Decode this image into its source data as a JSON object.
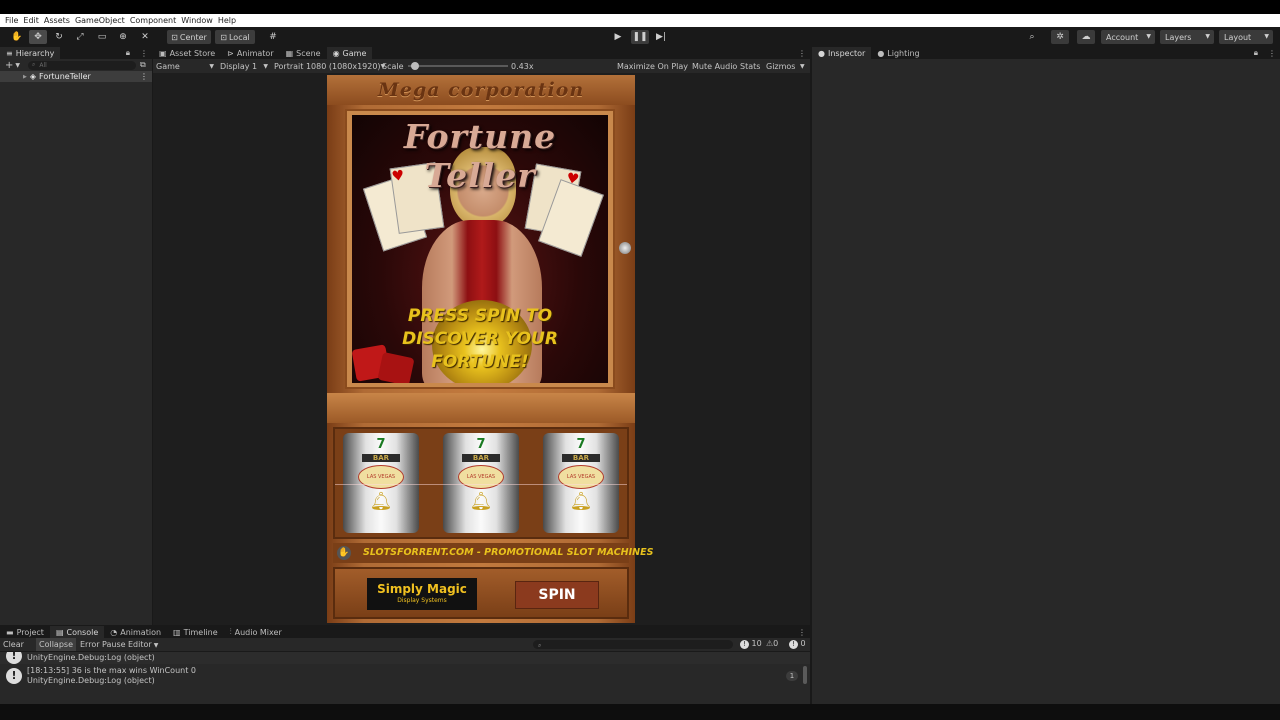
{
  "menu": [
    "File",
    "Edit",
    "Assets",
    "GameObject",
    "Component",
    "Window",
    "Help"
  ],
  "toolbar": {
    "pivot_center": "Center",
    "pivot_local": "Local",
    "account": "Account",
    "layers": "Layers",
    "layout": "Layout"
  },
  "hierarchy": {
    "tab": "Hierarchy",
    "search_placeholder": "All",
    "items": [
      {
        "label": "FortuneTeller"
      }
    ]
  },
  "game_view": {
    "tabs": [
      "Asset Store",
      "Animator",
      "Scene",
      "Game"
    ],
    "active_tab": "Game",
    "mode": "Game",
    "display": "Display 1",
    "resolution": "Portrait 1080 (1080x1920)",
    "scale_label": "Scale",
    "scale_value": "0.43x",
    "scale_fraction": 0.03,
    "toggles": [
      "Maximize On Play",
      "Mute Audio",
      "Stats",
      "Gizmos"
    ]
  },
  "slot_machine": {
    "header": "Mega corporation",
    "title": "Fortune Teller",
    "prompt_lines": [
      "PRESS SPIN TO",
      "DISCOVER YOUR",
      "FORTUNE!"
    ],
    "banner": "SLOTSFORRENT.COM - PROMOTIONAL SLOT MACHINES",
    "logo_main": "Simply Magic",
    "logo_sub": "Display Systems",
    "spin_label": "SPIN",
    "reel_symbols": [
      "7",
      "BAR",
      "LAS VEGAS",
      "bell"
    ]
  },
  "inspector": {
    "tabs": [
      "Inspector",
      "Lighting"
    ]
  },
  "console": {
    "tabs": [
      "Project",
      "Console",
      "Animation",
      "Timeline",
      "Audio Mixer"
    ],
    "active_tab": "Console",
    "buttons": [
      "Clear",
      "Collapse",
      "Error Pause",
      "Editor"
    ],
    "counts": {
      "info": "10",
      "warn": "0",
      "error": "0"
    },
    "entries": [
      {
        "line1": "",
        "line2": "UnityEngine.Debug:Log (object)",
        "count": ""
      },
      {
        "line1": "[18:13:55] 36 is the max wins WinCount 0",
        "line2": "UnityEngine.Debug:Log (object)",
        "count": "1"
      }
    ]
  },
  "colors": {
    "editor_bg": "#282828",
    "dark_bg": "#191919",
    "wood": "#b06b35",
    "gold_text": "#e8c21d",
    "spin_bg": "#8b3a1e"
  }
}
